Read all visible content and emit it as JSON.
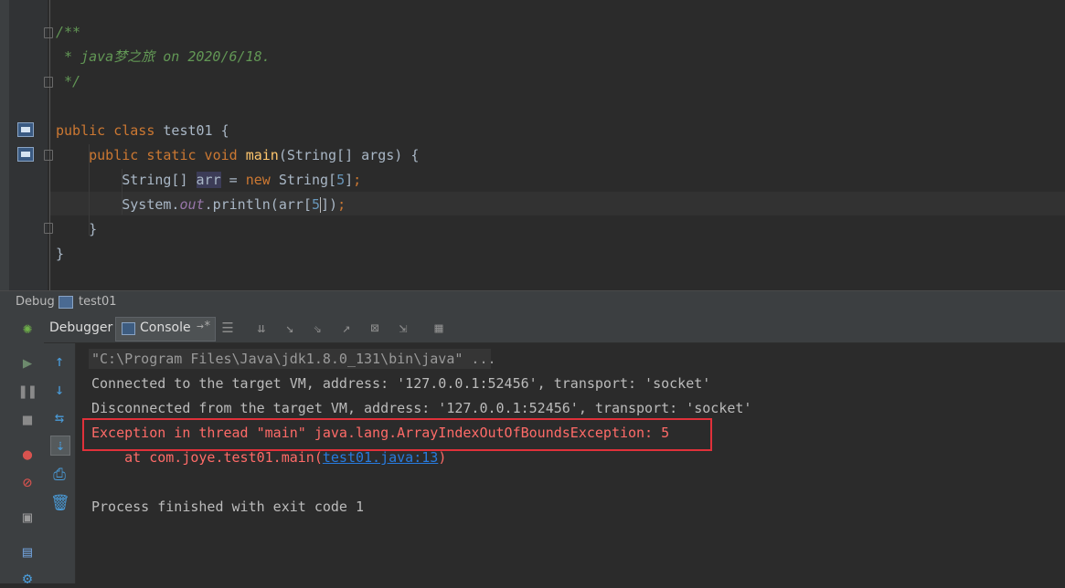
{
  "editor": {
    "lines": [
      {
        "parts": [
          {
            "t": "/**",
            "c": "cm"
          }
        ]
      },
      {
        "parts": [
          {
            "t": " * java梦之旅 on 2020/6/18.",
            "c": "cm"
          }
        ]
      },
      {
        "parts": [
          {
            "t": " */",
            "c": "cm"
          }
        ]
      },
      {
        "parts": []
      },
      {
        "parts": [
          {
            "t": "public class",
            "c": "kw"
          },
          {
            "t": " test01 {",
            "c": ""
          }
        ]
      },
      {
        "parts": [
          {
            "t": "    "
          },
          {
            "t": "public static void",
            "c": "kw"
          },
          {
            "t": " "
          },
          {
            "t": "main",
            "c": "fn"
          },
          {
            "t": "(String[] args) {"
          }
        ]
      },
      {
        "parts": [
          {
            "t": "        String[] "
          },
          {
            "t": "arr",
            "c": "hl-var"
          },
          {
            "t": " = "
          },
          {
            "t": "new",
            "c": "kw"
          },
          {
            "t": " String["
          },
          {
            "t": "5",
            "c": "num"
          },
          {
            "t": "]"
          },
          {
            "t": ";",
            "c": "kw"
          }
        ]
      },
      {
        "parts": [
          {
            "t": "        System."
          },
          {
            "t": "out",
            "c": "fld"
          },
          {
            "t": ".println(arr["
          },
          {
            "t": "5",
            "c": "num"
          },
          {
            "t": "CARET"
          },
          {
            "t": "])"
          },
          {
            "t": ";",
            "c": "kw"
          }
        ]
      },
      {
        "parts": [
          {
            "t": "    }"
          }
        ]
      },
      {
        "parts": [
          {
            "t": "}"
          }
        ]
      }
    ]
  },
  "debug": {
    "title": "Debug",
    "config_name": "test01",
    "tabs": {
      "debugger": "Debugger",
      "console": "Console",
      "console_pin": "→*"
    }
  },
  "console": {
    "lines": [
      {
        "kind": "cmd",
        "text": "\"C:\\Program Files\\Java\\jdk1.8.0_131\\bin\\java\" ..."
      },
      {
        "kind": "normal",
        "text": "Connected to the target VM, address: '127.0.0.1:52456', transport: 'socket'"
      },
      {
        "kind": "normal",
        "text": "Disconnected from the target VM, address: '127.0.0.1:52456', transport: 'socket'"
      },
      {
        "kind": "err",
        "text": "Exception in thread \"main\" java.lang.ArrayIndexOutOfBoundsException: 5"
      },
      {
        "kind": "err",
        "text": "    at com.joye.test01.main(",
        "link": "test01.java:13",
        "after": ")"
      },
      {
        "kind": "normal",
        "text": ""
      },
      {
        "kind": "normal",
        "text": "Process finished with exit code 1"
      }
    ]
  },
  "icons": {
    "toolbar": [
      "console-layout-icon",
      "show-execution-point-icon",
      "step-over-icon",
      "step-into-icon",
      "force-step-into-icon",
      "step-out-icon",
      "drop-frame-icon",
      "run-to-cursor-icon",
      "evaluate-expression-icon"
    ],
    "left_column": [
      "debug-bug-icon",
      "resume-icon",
      "pause-icon",
      "stop-icon",
      "view-breakpoints-icon",
      "mute-breakpoints-icon",
      "get-thread-dump-icon",
      "settings-icon",
      "layout-icon"
    ],
    "console_column": [
      "up-arrow-icon",
      "down-arrow-icon",
      "soft-wrap-icon",
      "scroll-to-end-icon",
      "print-icon",
      "clear-all-icon"
    ]
  },
  "colors": {
    "error": "#ff6b68",
    "highlight_box": "#e0313a",
    "link": "#287bde"
  }
}
